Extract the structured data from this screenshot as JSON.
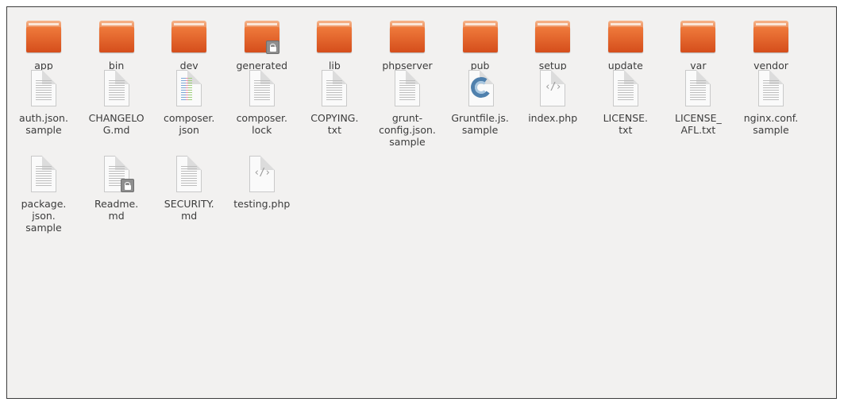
{
  "files": [
    {
      "name": "app",
      "type": "folder",
      "locked": false
    },
    {
      "name": "bin",
      "type": "folder",
      "locked": false
    },
    {
      "name": "dev",
      "type": "folder",
      "locked": false
    },
    {
      "name": "generated",
      "type": "folder",
      "locked": true
    },
    {
      "name": "lib",
      "type": "folder",
      "locked": false
    },
    {
      "name": "phpserver",
      "type": "folder",
      "locked": false
    },
    {
      "name": "pub",
      "type": "folder",
      "locked": false
    },
    {
      "name": "setup",
      "type": "folder",
      "locked": false
    },
    {
      "name": "update",
      "type": "folder",
      "locked": false
    },
    {
      "name": "var",
      "type": "folder",
      "locked": false
    },
    {
      "name": "vendor",
      "type": "folder",
      "locked": false
    },
    {
      "name": "auth.json.\nsample",
      "type": "text",
      "locked": false
    },
    {
      "name": "CHANGELO\nG.md",
      "type": "text",
      "locked": false
    },
    {
      "name": "composer.\njson",
      "type": "code-doc",
      "locked": false
    },
    {
      "name": "composer.\nlock",
      "type": "text",
      "locked": false
    },
    {
      "name": "COPYING.\ntxt",
      "type": "text",
      "locked": false
    },
    {
      "name": "grunt-\nconfig.json.\nsample",
      "type": "text",
      "locked": false
    },
    {
      "name": "Gruntfile.js.\nsample",
      "type": "grunt",
      "locked": false
    },
    {
      "name": "index.php",
      "type": "php",
      "locked": false
    },
    {
      "name": "LICENSE.\ntxt",
      "type": "text",
      "locked": false
    },
    {
      "name": "LICENSE_\nAFL.txt",
      "type": "text",
      "locked": false
    },
    {
      "name": "nginx.conf.\nsample",
      "type": "text",
      "locked": false
    },
    {
      "name": "package.\njson.\nsample",
      "type": "text",
      "locked": false
    },
    {
      "name": "Readme.\nmd",
      "type": "text",
      "locked": true
    },
    {
      "name": "SECURITY.\nmd",
      "type": "text",
      "locked": false
    },
    {
      "name": "testing.php",
      "type": "php",
      "locked": false
    }
  ],
  "colors": {
    "background": "#f2f1f0",
    "folder": "#e2622d",
    "text": "#3c3c3c"
  }
}
